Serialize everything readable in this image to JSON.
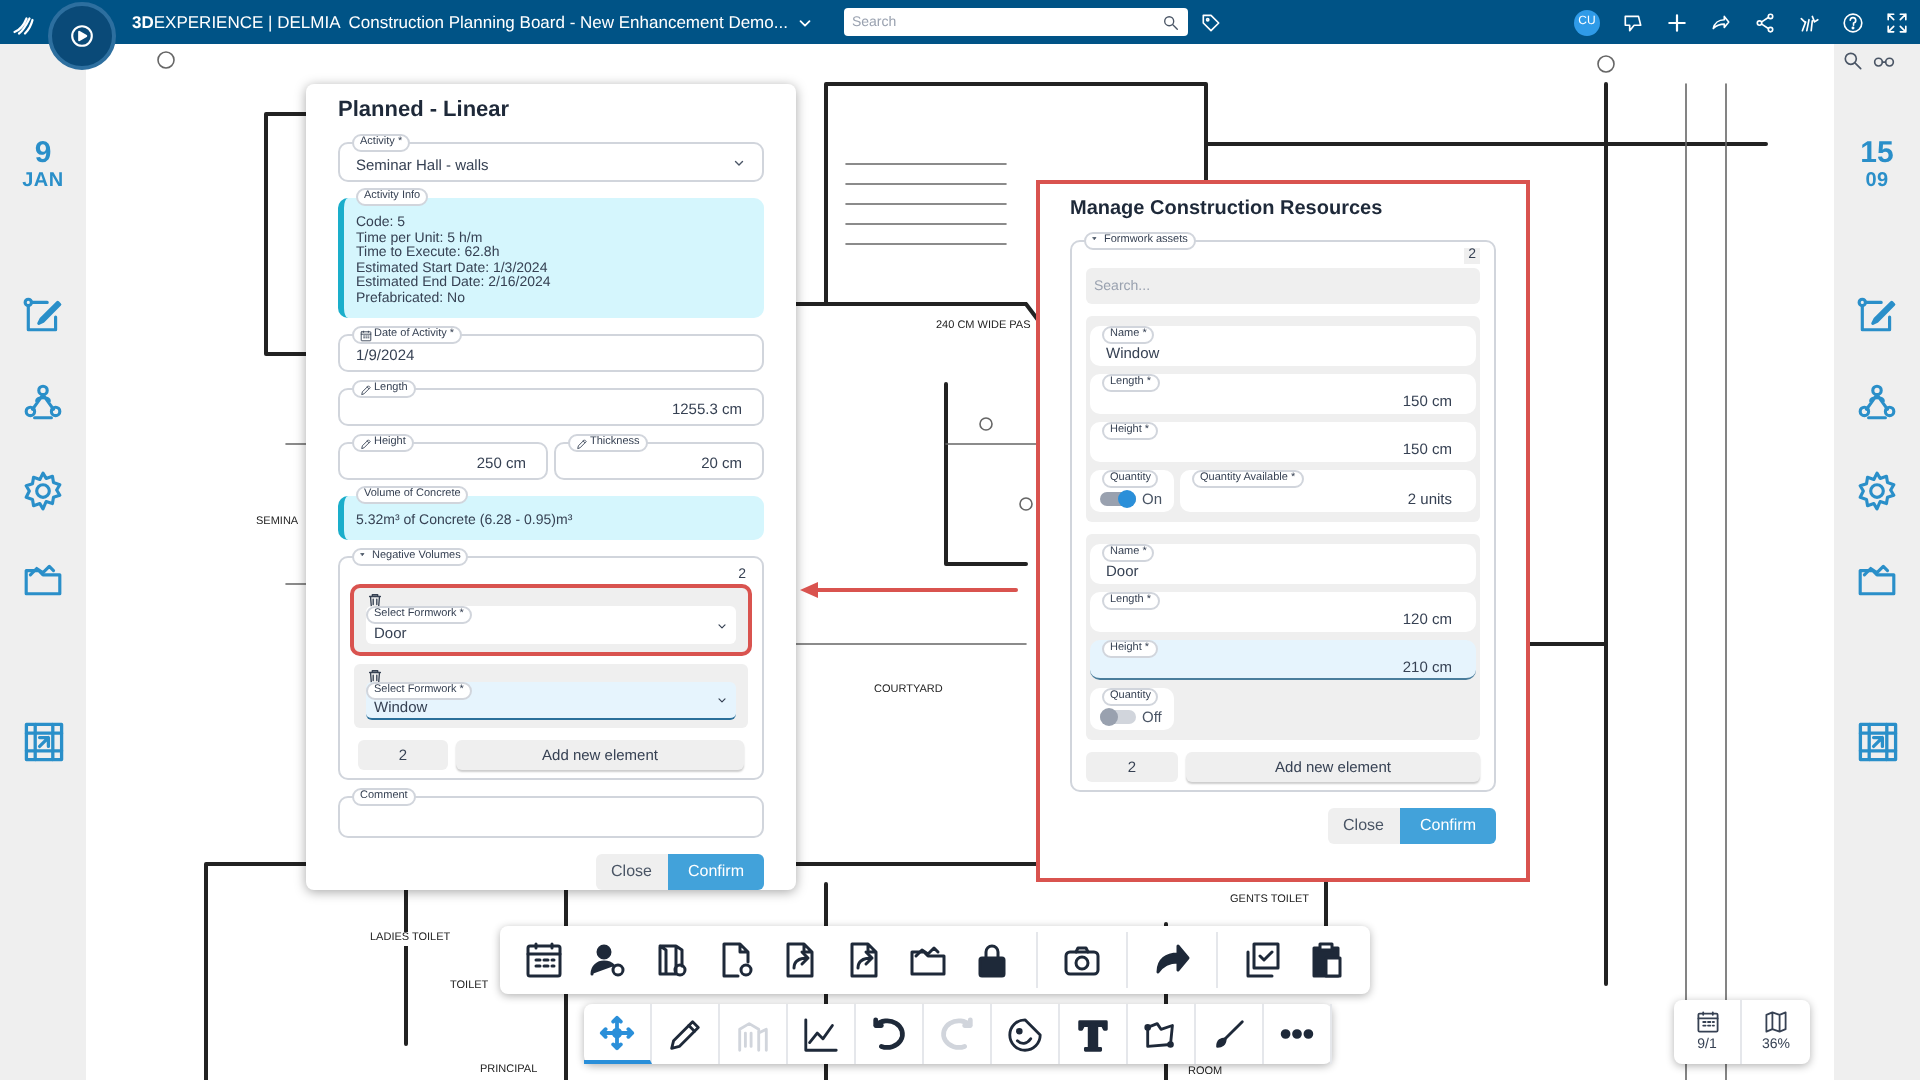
{
  "header": {
    "brand_bold": "3D",
    "brand": "EXPERIENCE | DELMIA",
    "title": "Construction Planning Board - New Enhancement Demo...",
    "search": {
      "placeholder": "Search"
    },
    "user_initials": "CU"
  },
  "left_sidebar": {
    "day": "9",
    "month": "JAN"
  },
  "right_sidebar": {
    "day": "15",
    "month": "09"
  },
  "floor_plan": {
    "labels": [
      "SEMINA",
      "240 CM WIDE PAS",
      "COURTYARD",
      "LADIES TOILET",
      "TOILET",
      "PRINCIPAL",
      "GENTS TOILET",
      "ROOM"
    ]
  },
  "planned_dialog": {
    "title": "Planned - Linear",
    "activity": {
      "label": "Activity *",
      "value": "Seminar Hall - walls"
    },
    "activity_info": {
      "label": "Activity Info",
      "lines": [
        "Code: 5",
        "Time per Unit: 5 h/m",
        "Time to Execute: 62.8h",
        "Estimated Start Date: 1/3/2024",
        "Estimated End Date: 2/16/2024",
        "Prefabricated: No"
      ]
    },
    "date": {
      "label": "Date of Activity *",
      "value": "1/9/2024"
    },
    "length": {
      "label": "Length",
      "value": "1255.3 cm"
    },
    "height": {
      "label": "Height",
      "value": "250 cm"
    },
    "thickness": {
      "label": "Thickness",
      "value": "20 cm"
    },
    "volume": {
      "label": "Volume of Concrete",
      "value": "5.32m³ of Concrete (6.28 - 0.95)m³"
    },
    "negative_volumes": {
      "label": "Negative Volumes",
      "expanded": true,
      "count": "2",
      "items": [
        {
          "label": "Select Formwork *",
          "value": "Door",
          "highlighted": true,
          "focused": false
        },
        {
          "label": "Select Formwork *",
          "value": "Window",
          "highlighted": false,
          "focused": true
        }
      ],
      "counter": "2",
      "add_button": "Add new element"
    },
    "comment": {
      "label": "Comment"
    },
    "buttons": [
      {
        "label": "Close",
        "primary": false
      },
      {
        "label": "Confirm",
        "primary": true
      }
    ]
  },
  "resources_dialog": {
    "title": "Manage Construction Resources",
    "highlighted": true,
    "group": {
      "label": "Formwork assets",
      "expanded": true,
      "count": "2",
      "search": {
        "placeholder": "Search..."
      },
      "assets": [
        {
          "fields": [
            {
              "label": "Name *",
              "value": "Window",
              "kind": "text",
              "focused": false
            },
            {
              "label": "Length *",
              "value": "150 cm",
              "kind": "measure",
              "focused": false
            },
            {
              "label": "Height *",
              "value": "150 cm",
              "kind": "measure",
              "focused": false
            }
          ],
          "quantity": {
            "label": "Quantity",
            "on": true,
            "state_label": "On"
          },
          "available": {
            "label": "Quantity Available *",
            "value": "2 units"
          }
        },
        {
          "fields": [
            {
              "label": "Name *",
              "value": "Door",
              "kind": "text",
              "focused": false
            },
            {
              "label": "Length *",
              "value": "120 cm",
              "kind": "measure",
              "focused": false
            },
            {
              "label": "Height *",
              "value": "210 cm",
              "kind": "measure",
              "focused": true
            }
          ],
          "quantity": {
            "label": "Quantity",
            "on": false,
            "state_label": "Off"
          }
        }
      ],
      "counter": "2",
      "add_button": "Add new element"
    },
    "buttons": [
      {
        "label": "Close",
        "primary": false
      },
      {
        "label": "Confirm",
        "primary": true
      }
    ]
  },
  "drawing_tools": [
    {
      "selected": true,
      "disabled": false
    },
    {
      "selected": false,
      "disabled": false
    },
    {
      "selected": false,
      "disabled": true
    },
    {
      "selected": false,
      "disabled": false
    },
    {
      "selected": false,
      "disabled": false
    },
    {
      "selected": false,
      "disabled": true
    },
    {
      "selected": false,
      "disabled": false
    },
    {
      "selected": false,
      "disabled": false
    },
    {
      "selected": false,
      "disabled": false
    },
    {
      "selected": false,
      "disabled": false
    },
    {
      "selected": false,
      "disabled": false
    }
  ],
  "status_panel": {
    "date": "9/1",
    "zoom": "36%"
  }
}
